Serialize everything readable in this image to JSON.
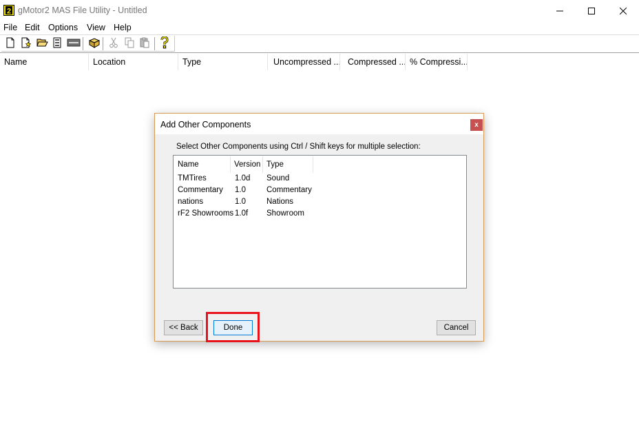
{
  "window": {
    "title": "gMotor2 MAS File Utility - Untitled",
    "app_icon_glyph": "2",
    "minimize_icon": "minimize-icon",
    "maximize_icon": "maximize-icon",
    "close_icon": "close-icon"
  },
  "menu": {
    "items": [
      "File",
      "Edit",
      "Options",
      "View",
      "Help"
    ]
  },
  "toolbar": {
    "buttons": [
      "new-file-icon",
      "add-file-icon",
      "open-folder-icon",
      "extract-icon",
      "properties-icon",
      "package-icon",
      "cut-icon",
      "copy-icon",
      "paste-icon",
      "help-icon"
    ]
  },
  "file_list": {
    "columns": [
      "Name",
      "Location",
      "Type",
      "Uncompressed ...",
      "Compressed ...",
      "% Compressi..."
    ]
  },
  "dialog": {
    "title": "Add Other Components",
    "close_label": "x",
    "instruction": "Select Other Components using Ctrl / Shift keys for multiple selection:",
    "columns": [
      "Name",
      "Version",
      "Type"
    ],
    "rows": [
      [
        "TMTires",
        "1.0d",
        "Sound"
      ],
      [
        "Commentary",
        "1.0",
        "Commentary"
      ],
      [
        "nations",
        "1.0",
        "Nations"
      ],
      [
        "rF2 Showrooms",
        "1.0f",
        "Showroom"
      ]
    ],
    "back_label": "<< Back",
    "done_label": "Done",
    "cancel_label": "Cancel"
  },
  "colors": {
    "highlight": "#e8131a",
    "dialog_border": "#d99a55",
    "close_red": "#c75050",
    "focus_blue": "#0078d7"
  }
}
